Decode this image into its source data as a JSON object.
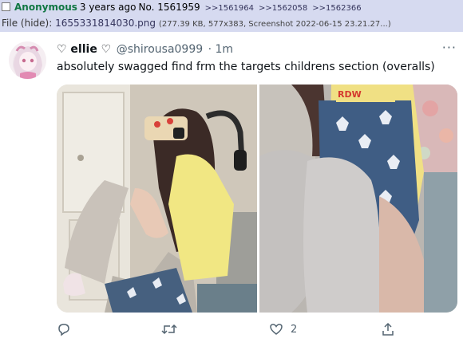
{
  "post": {
    "name": "Anonymous",
    "date": "3 years ago",
    "number": "No. 1561959",
    "backlinks": [
      ">>1561964",
      ">>1562058",
      ">>1562366"
    ]
  },
  "file": {
    "prefix": "File",
    "hide_label": "(hide)",
    "separator": ":",
    "filename": "1655331814030.png",
    "meta": "(277.39 KB, 577x383, Screenshot 2022-06-15 23.21.27...)"
  },
  "tweet": {
    "display_name": "♡ ellie ♡",
    "handle": "@shirousa0999",
    "time": "· 1m",
    "more_icon": "···",
    "text": "absolutely swagged find frm the targets childrens section (overalls)",
    "actions": {
      "reply_icon": "reply-icon",
      "retweet_icon": "retweet-icon",
      "like_icon": "heart-icon",
      "like_count": "2",
      "share_icon": "share-icon"
    }
  },
  "colors": {
    "background": "#d6daf0",
    "name_green": "#117743",
    "link_blue": "#34345c",
    "tweet_gray": "#536471",
    "tweet_text": "#0f1419"
  }
}
